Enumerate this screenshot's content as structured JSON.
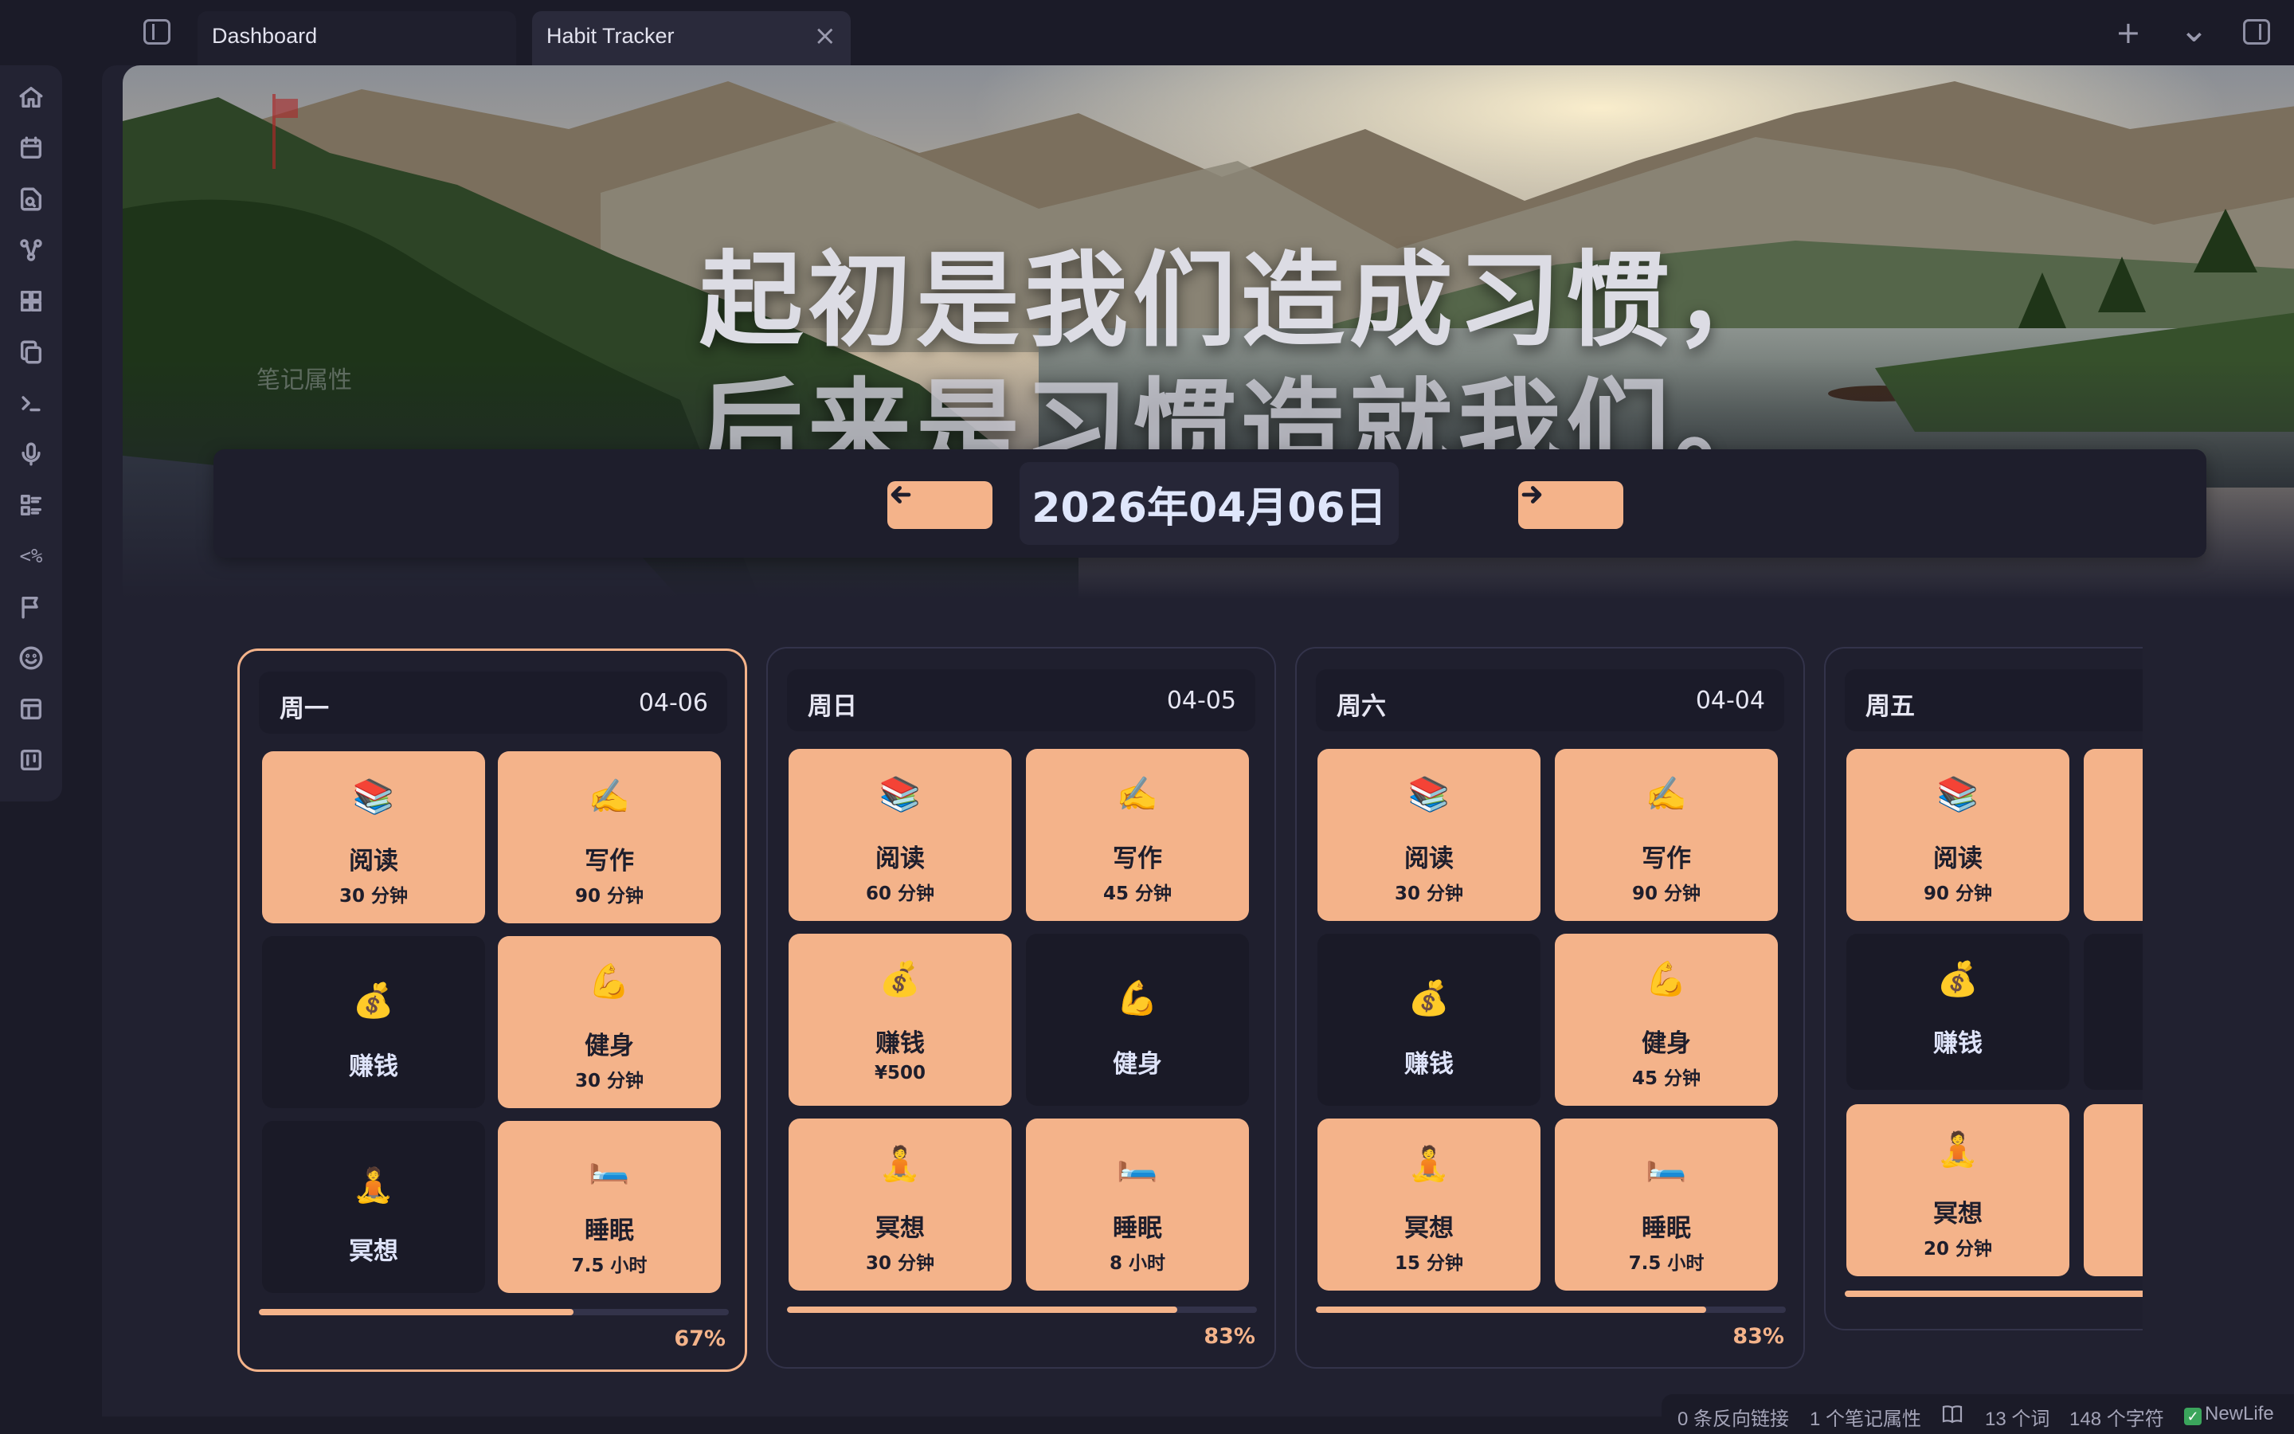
{
  "tabs": [
    {
      "label": "Dashboard",
      "active": false
    },
    {
      "label": "Habit Tracker",
      "active": true
    }
  ],
  "titlebar": {
    "close_icon": "×",
    "new_tab_icon": "+",
    "tab_list_icon": "⌄"
  },
  "ribbon": {
    "icons": [
      "home-icon",
      "calendar-icon",
      "file-search-icon",
      "graph-icon",
      "grid-icon",
      "copy-icon",
      "terminal-icon",
      "microphone-icon",
      "list-icon",
      "template-icon",
      "flag-icon",
      "smile-icon",
      "layout-icon",
      "kanban-icon"
    ],
    "template_glyph": "<%"
  },
  "banner": {
    "quote_line1": "起初是我们造成习惯，",
    "quote_line2": "后来是习惯造就我们。",
    "ghost_label": "笔记属性"
  },
  "date_nav": {
    "current_date": "2026年04月06日",
    "prev_icon": "arrow-left-icon",
    "next_icon": "arrow-right-icon"
  },
  "accent_color": "#f4b38a",
  "days": [
    {
      "name": "周一",
      "date": "04-06",
      "active": true,
      "progress": 0.67,
      "progress_label": "67%",
      "habits": [
        {
          "emoji": "📚",
          "name": "阅读",
          "value": "30 分钟",
          "done": true
        },
        {
          "emoji": "✍️",
          "name": "写作",
          "value": "90 分钟",
          "done": true
        },
        {
          "emoji": "💰",
          "name": "赚钱",
          "value": "",
          "done": false
        },
        {
          "emoji": "💪",
          "name": "健身",
          "value": "30 分钟",
          "done": true
        },
        {
          "emoji": "🧘",
          "name": "冥想",
          "value": "",
          "done": false
        },
        {
          "emoji": "🛏️",
          "name": "睡眠",
          "value": "7.5 小时",
          "done": true
        }
      ]
    },
    {
      "name": "周日",
      "date": "04-05",
      "active": false,
      "progress": 0.83,
      "progress_label": "83%",
      "habits": [
        {
          "emoji": "📚",
          "name": "阅读",
          "value": "60 分钟",
          "done": true
        },
        {
          "emoji": "✍️",
          "name": "写作",
          "value": "45 分钟",
          "done": true
        },
        {
          "emoji": "💰",
          "name": "赚钱",
          "value": "¥500",
          "done": true
        },
        {
          "emoji": "💪",
          "name": "健身",
          "value": "",
          "done": false
        },
        {
          "emoji": "🧘",
          "name": "冥想",
          "value": "30 分钟",
          "done": true
        },
        {
          "emoji": "🛏️",
          "name": "睡眠",
          "value": "8 小时",
          "done": true
        }
      ]
    },
    {
      "name": "周六",
      "date": "04-04",
      "active": false,
      "progress": 0.83,
      "progress_label": "83%",
      "habits": [
        {
          "emoji": "📚",
          "name": "阅读",
          "value": "30 分钟",
          "done": true
        },
        {
          "emoji": "✍️",
          "name": "写作",
          "value": "90 分钟",
          "done": true
        },
        {
          "emoji": "💰",
          "name": "赚钱",
          "value": "",
          "done": false
        },
        {
          "emoji": "💪",
          "name": "健身",
          "value": "45 分钟",
          "done": true
        },
        {
          "emoji": "🧘",
          "name": "冥想",
          "value": "15 分钟",
          "done": true
        },
        {
          "emoji": "🛏️",
          "name": "睡眠",
          "value": "7.5 小时",
          "done": true
        }
      ]
    },
    {
      "name": "周五",
      "date": "",
      "active": false,
      "progress": null,
      "progress_label": "",
      "habits": [
        {
          "emoji": "📚",
          "name": "阅读",
          "value": "90 分钟",
          "done": true
        },
        {
          "emoji": "",
          "name": "",
          "value": "",
          "done": true
        },
        {
          "emoji": "💰",
          "name": "赚钱",
          "value": "",
          "done": false,
          "has_value_row": true
        },
        {
          "emoji": "",
          "name": "",
          "value": "",
          "done": false
        },
        {
          "emoji": "🧘",
          "name": "冥想",
          "value": "20 分钟",
          "done": true
        },
        {
          "emoji": "",
          "name": "",
          "value": "",
          "done": true
        }
      ]
    }
  ],
  "statusbar": {
    "backlinks": "0 条反向链接",
    "properties": "1 个笔记属性",
    "words": "13 个词",
    "chars": "148 个字符",
    "plugin": "NewLife"
  }
}
